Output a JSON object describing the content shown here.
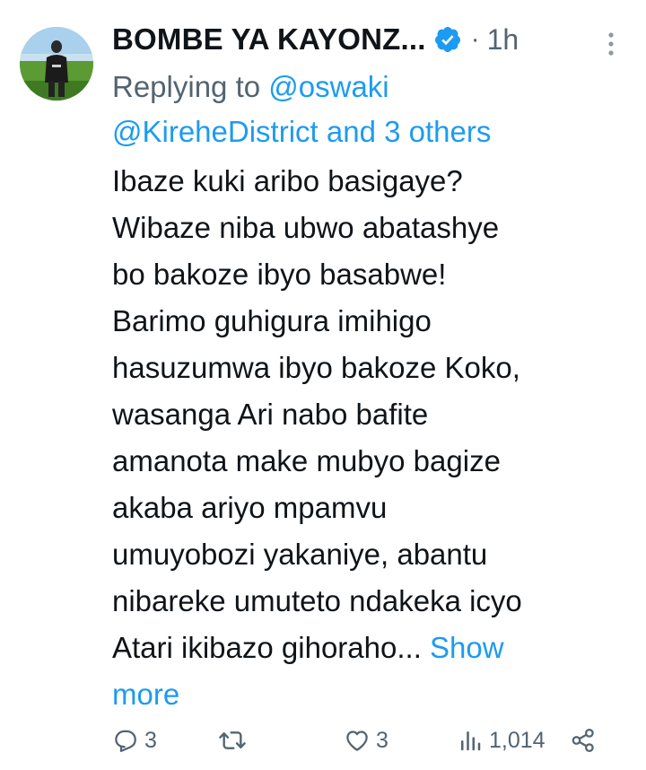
{
  "tweet": {
    "author_name": "BOMBE YA KAYONZ...",
    "separator": "·",
    "time": "1h",
    "reply_prefix": "Replying to ",
    "reply_handle_1": "@oswaki",
    "reply_handle_2": "@KireheDistrict",
    "reply_conjunction": " and ",
    "reply_others": "3 others",
    "body_lines": [
      "Ibaze kuki aribo basigaye?",
      "Wibaze niba ubwo abatashye",
      "bo bakoze ibyo basabwe!",
      "Barimo guhigura imihigo",
      "hasuzumwa ibyo bakoze Koko,",
      "wasanga Ari nabo bafite",
      "amanota make mubyo bagize",
      "akaba ariyo mpamvu",
      "umuyobozi yakaniye, abantu",
      "nibareke umuteto ndakeka icyo",
      "Atari ikibazo gihoraho... "
    ],
    "show_more_part1": "Show",
    "show_more_part2": "more"
  },
  "actions": {
    "reply_count": "3",
    "retweet_count": "",
    "like_count": "3",
    "views_count": "1,014"
  },
  "icons": {
    "verified": "verified-badge-icon",
    "more": "more-vertical-icon",
    "reply": "reply-icon",
    "retweet": "retweet-icon",
    "like": "heart-icon",
    "views": "views-chart-icon",
    "share": "share-icon"
  },
  "colors": {
    "link": "#1d9bf0",
    "secondary_text": "#536471",
    "primary_text": "#0f1419"
  }
}
